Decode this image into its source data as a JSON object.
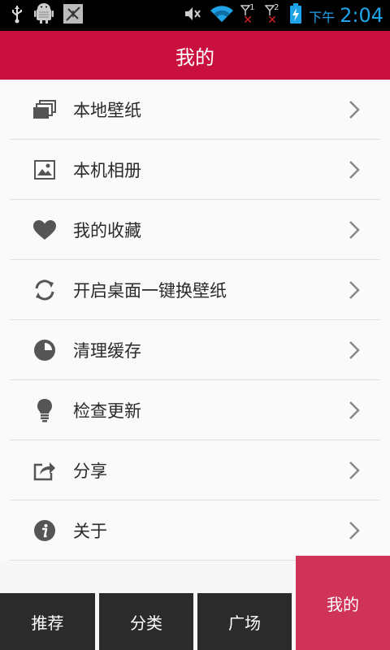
{
  "status_bar": {
    "ampm": "下午",
    "time": "2:04",
    "sim1_label": "1",
    "sim2_label": "2",
    "accent_color": "#1fa4e9"
  },
  "header": {
    "title": "我的",
    "background": "#c9103e"
  },
  "menu": {
    "items": [
      {
        "label": "本地壁纸",
        "icon": "gallery-stack-icon"
      },
      {
        "label": "本机相册",
        "icon": "image-icon"
      },
      {
        "label": "我的收藏",
        "icon": "heart-icon"
      },
      {
        "label": "开启桌面一键换壁纸",
        "icon": "refresh-icon"
      },
      {
        "label": "清理缓存",
        "icon": "pie-chart-icon"
      },
      {
        "label": "检查更新",
        "icon": "lightbulb-icon"
      },
      {
        "label": "分享",
        "icon": "share-icon"
      },
      {
        "label": "关于",
        "icon": "info-icon"
      }
    ]
  },
  "tabbar": {
    "tabs": [
      {
        "label": "推荐"
      },
      {
        "label": "分类"
      },
      {
        "label": "广场"
      },
      {
        "label": "我的",
        "active": true
      }
    ],
    "active_color": "#cf3458",
    "inactive_color": "#2b2b2b"
  }
}
